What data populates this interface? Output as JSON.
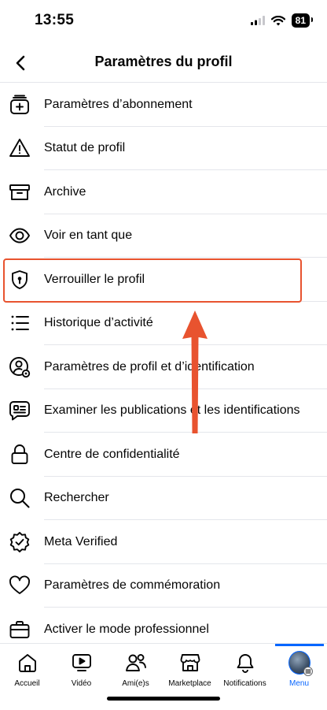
{
  "status_bar": {
    "time": "13:55",
    "battery": "81"
  },
  "header": {
    "title": "Paramètres du profil",
    "back_icon": "chevron-left-icon"
  },
  "menu_items": [
    {
      "label": "Paramètres d’abonnement",
      "icon": "subscription-add-icon"
    },
    {
      "label": "Statut de profil",
      "icon": "warning-triangle-icon"
    },
    {
      "label": "Archive",
      "icon": "archive-box-icon"
    },
    {
      "label": "Voir en tant que",
      "icon": "eye-icon"
    },
    {
      "label": "Verrouiller le profil",
      "icon": "shield-lock-icon"
    },
    {
      "label": "Historique d’activité",
      "icon": "list-icon"
    },
    {
      "label": "Paramètres de profil et d’identification",
      "icon": "person-gear-icon"
    },
    {
      "label": "Examiner les publications et les identifications",
      "icon": "review-posts-icon"
    },
    {
      "label": "Centre de confidentialité",
      "icon": "lock-icon"
    },
    {
      "label": "Rechercher",
      "icon": "search-icon"
    },
    {
      "label": "Meta Verified",
      "icon": "verified-badge-icon"
    },
    {
      "label": "Paramètres de commémoration",
      "icon": "heart-icon"
    },
    {
      "label": "Activer le mode professionnel",
      "icon": "briefcase-icon"
    }
  ],
  "highlighted_item": "Verrouiller le profil",
  "tabs": [
    {
      "label": "Accueil",
      "icon": "home-icon"
    },
    {
      "label": "Vidéo",
      "icon": "video-icon"
    },
    {
      "label": "Ami(e)s",
      "icon": "friends-icon"
    },
    {
      "label": "Marketplace",
      "icon": "marketplace-icon"
    },
    {
      "label": "Notifications",
      "icon": "bell-icon"
    },
    {
      "label": "Menu",
      "icon": "avatar-icon",
      "active": true
    }
  ],
  "colors": {
    "accent": "#0866ff",
    "annotation": "#e8532f",
    "text": "#050505",
    "divider": "#e4e6eb"
  }
}
